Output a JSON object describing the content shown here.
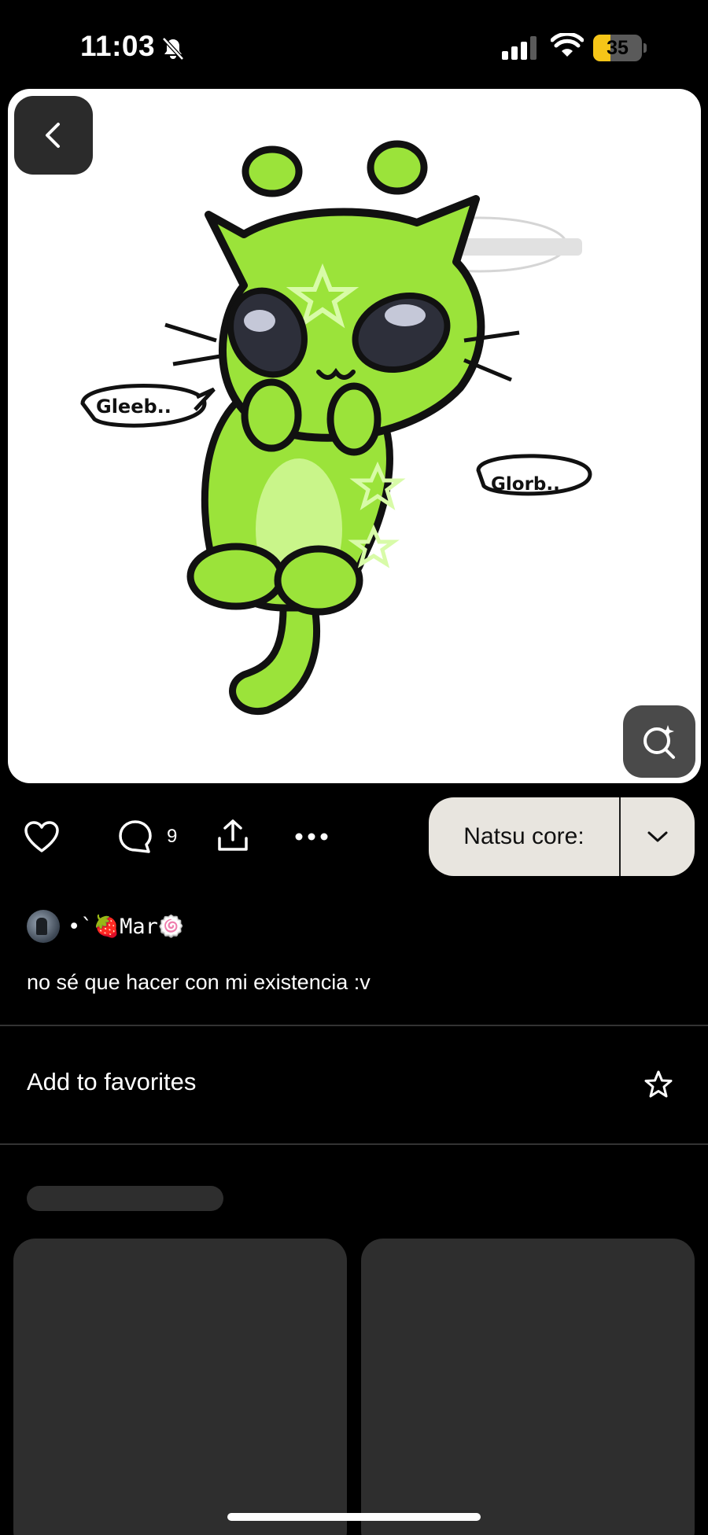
{
  "status_bar": {
    "time": "11:03",
    "battery_percent": "35",
    "battery_level": 0.35,
    "battery_color": "#f5c518",
    "icons": [
      "bell-slash-icon",
      "cellular-signal-icon",
      "wifi-icon",
      "battery-icon"
    ]
  },
  "pin": {
    "image_speech_left": "Gleeb..",
    "image_speech_right": "Glorb..",
    "back_icon": "chevron-left-icon",
    "visual_search_icon": "lens-search-icon"
  },
  "actions": {
    "like_icon": "heart-icon",
    "comment_icon": "comment-bubble-icon",
    "comment_count": "9",
    "share_icon": "share-icon",
    "more_icon": "ellipsis-icon",
    "board_name": "Natsu core:",
    "board_dropdown_icon": "chevron-down-icon"
  },
  "author": {
    "name": "•`🍓Mar🍥"
  },
  "description": "no sé que hacer con mi existencia :v",
  "favorites": {
    "label": "Add to favorites",
    "icon": "star-outline-icon"
  },
  "colors": {
    "background": "#000000",
    "board_button_bg": "#e8e5df",
    "skeleton": "#2e2e2e",
    "alien_green": "#9be33a"
  }
}
